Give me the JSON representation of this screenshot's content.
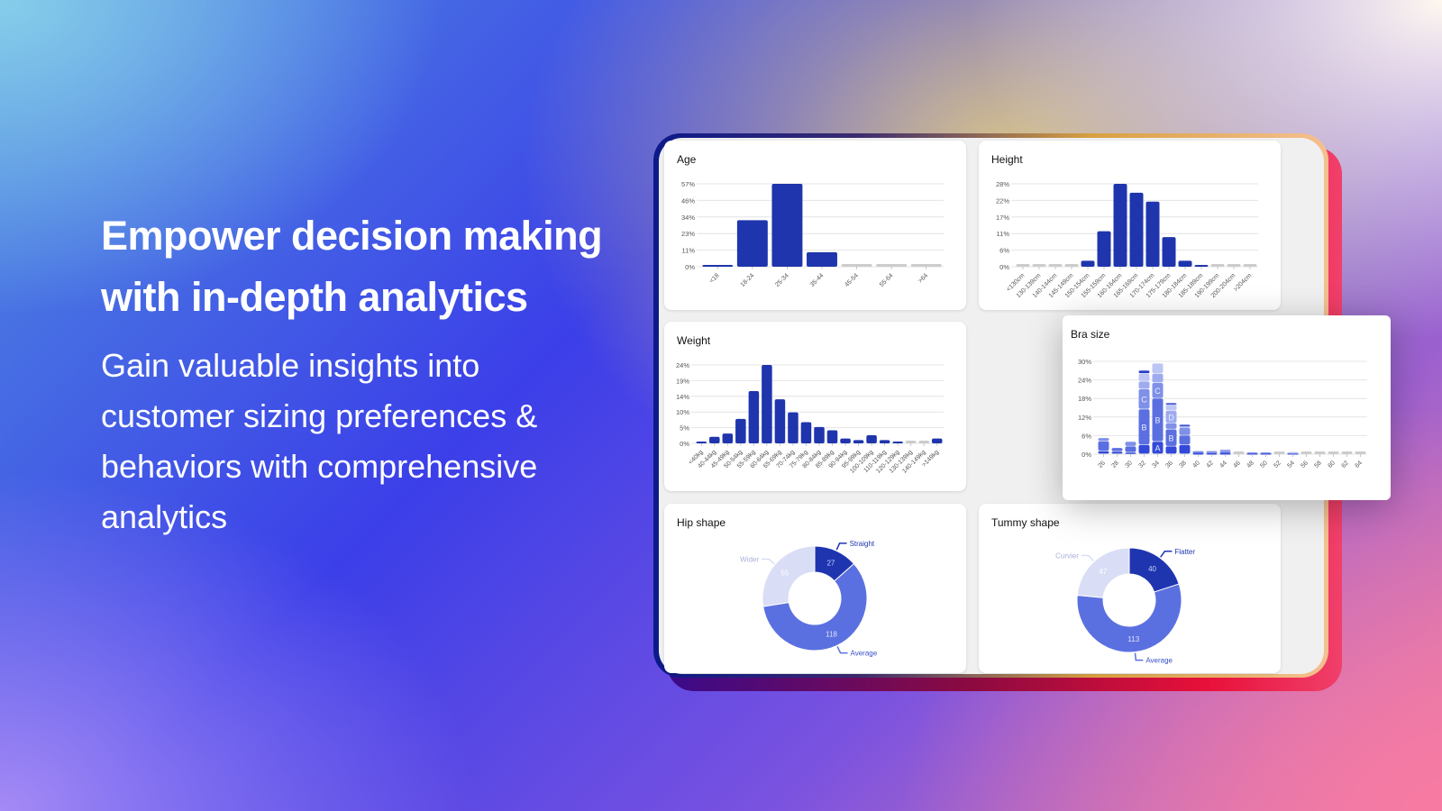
{
  "hero": {
    "headline": "Empower decision making with in-depth analytics",
    "subheadline": "Gain valuable insights into customer sizing preferences & behaviors with comprehensive analytics"
  },
  "colors": {
    "bar": "#1f35ad",
    "empty_bar": "#cccccc",
    "grid": "#e4e4e4",
    "donut": [
      "#1f35b0",
      "#5b70e0",
      "#d9ddf5"
    ],
    "stack": [
      "#3349d9",
      "#5b6fe0",
      "#7f90e8",
      "#9eabef",
      "#bcc5f4",
      "#2a3ec8"
    ]
  },
  "chart_data": [
    {
      "id": "age",
      "type": "bar",
      "title": "Age",
      "yticks": [
        "0%",
        "11%",
        "23%",
        "34%",
        "46%",
        "57%"
      ],
      "ylim": [
        0,
        57
      ],
      "categories": [
        "<18",
        "18-24",
        "25-34",
        "35-44",
        "45-54",
        "55-64",
        ">64"
      ],
      "values": [
        0.8,
        32,
        57,
        10,
        0,
        0,
        0
      ]
    },
    {
      "id": "height",
      "type": "bar",
      "title": "Height",
      "yticks": [
        "0%",
        "6%",
        "11%",
        "17%",
        "22%",
        "28%"
      ],
      "ylim": [
        0,
        28
      ],
      "categories": [
        "<130cm",
        "130-139cm",
        "140-144cm",
        "145-149cm",
        "150-154cm",
        "155-159cm",
        "160-164cm",
        "165-169cm",
        "170-174cm",
        "175-179cm",
        "180-184cm",
        "185-189cm",
        "190-199cm",
        "200-204cm",
        ">204cm"
      ],
      "values": [
        0,
        0,
        0,
        0,
        2,
        12,
        28,
        25,
        22,
        10,
        2,
        0.5,
        0,
        0,
        0
      ]
    },
    {
      "id": "weight",
      "type": "bar",
      "title": "Weight",
      "yticks": [
        "0%",
        "5%",
        "10%",
        "14%",
        "19%",
        "24%"
      ],
      "ylim": [
        0,
        24
      ],
      "categories": [
        "<40kg",
        "40-44kg",
        "45-49kg",
        "50-54kg",
        "55-59kg",
        "60-64kg",
        "65-69kg",
        "70-74kg",
        "75-79kg",
        "80-84kg",
        "85-89kg",
        "90-94kg",
        "95-99kg",
        "100-109kg",
        "110-119kg",
        "120-129kg",
        "130-139kg",
        "140-149kg",
        ">149kg"
      ],
      "values": [
        0.5,
        2,
        3,
        7.5,
        16,
        24,
        13.5,
        9.5,
        6.5,
        5,
        4,
        1.5,
        1,
        2.5,
        1,
        0.5,
        0,
        0,
        1.5
      ]
    },
    {
      "id": "bra",
      "type": "bar",
      "stacked": true,
      "title": "Bra size",
      "yticks": [
        "0%",
        "6%",
        "12%",
        "18%",
        "24%",
        "30%"
      ],
      "ylim": [
        0,
        30
      ],
      "categories": [
        "26",
        "28",
        "30",
        "32",
        "34",
        "36",
        "38",
        "40",
        "42",
        "44",
        "46",
        "48",
        "50",
        "52",
        "54",
        "56",
        "58",
        "60",
        "62",
        "64"
      ],
      "series": [
        {
          "name": "A",
          "values": [
            1,
            0.8,
            0.5,
            3,
            4,
            2.5,
            3,
            0.3,
            0.3,
            0.3,
            0,
            0.3,
            0.3,
            0,
            0.3,
            0,
            0,
            0,
            0,
            0
          ]
        },
        {
          "name": "B",
          "values": [
            3.2,
            1.2,
            2,
            11.5,
            14,
            5.5,
            3,
            0.4,
            0.5,
            0.4,
            0,
            0.2,
            0.2,
            0,
            0.1,
            0,
            0,
            0,
            0,
            0
          ]
        },
        {
          "name": "C",
          "values": [
            1,
            0,
            1.5,
            6.5,
            5,
            2,
            2.5,
            0.3,
            0.2,
            0.4,
            0,
            0,
            0,
            0,
            0,
            0,
            0,
            0,
            0,
            0
          ]
        },
        {
          "name": "D",
          "values": [
            0,
            0,
            0,
            2.5,
            3,
            4,
            0.5,
            0,
            0,
            0.4,
            0,
            0,
            0,
            0,
            0,
            0,
            0,
            0,
            0,
            0
          ]
        },
        {
          "name": "",
          "values": [
            0,
            0,
            0,
            2.5,
            3.3,
            2,
            0,
            0,
            0,
            0,
            0,
            0,
            0,
            0,
            0.3,
            0,
            0,
            0,
            0,
            0
          ]
        },
        {
          "name": "",
          "values": [
            0,
            0,
            0,
            1,
            0,
            0.5,
            0.5,
            0,
            0,
            0,
            0,
            0,
            0,
            0,
            0,
            0,
            0,
            0,
            0,
            0
          ]
        }
      ]
    },
    {
      "id": "hip",
      "type": "pie",
      "donut": true,
      "title": "Hip shape",
      "slices": [
        {
          "label": "Straight",
          "value": 27
        },
        {
          "label": "Average",
          "value": 118
        },
        {
          "label": "Wider",
          "value": 55
        }
      ]
    },
    {
      "id": "tummy",
      "type": "pie",
      "donut": true,
      "title": "Tummy shape",
      "slices": [
        {
          "label": "Flatter",
          "value": 40
        },
        {
          "label": "Average",
          "value": 113
        },
        {
          "label": "Curvier",
          "value": 47
        }
      ]
    }
  ]
}
